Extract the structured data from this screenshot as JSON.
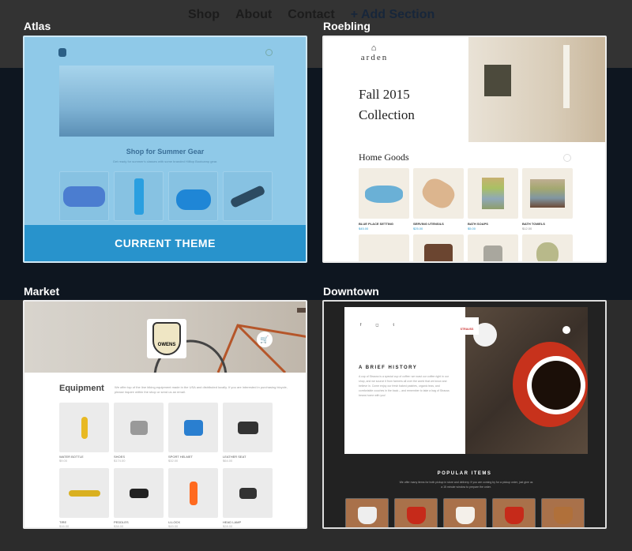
{
  "background": {
    "nav": [
      "Shop",
      "About",
      "Contact",
      "+ Add Section"
    ]
  },
  "themes": [
    {
      "name": "Atlas",
      "current": true,
      "badge": "CURRENT THEME",
      "heading": "Shop for Summer Gear",
      "subtitle": "Get ready for summer's classes with some branded Hilltop Bootcamp gear."
    },
    {
      "name": "Roebling",
      "logo": "arden",
      "headline": [
        "Fall 2015",
        "Collection"
      ],
      "section": "Home Goods",
      "products": [
        {
          "name": "Blue Place Setting",
          "price": "$45.00"
        },
        {
          "name": "Serving Utensils",
          "price": "$25.00"
        },
        {
          "name": "Bath Soaps",
          "price": "$5.00"
        },
        {
          "name": "Bath Towels",
          "price": "$12.00"
        }
      ]
    },
    {
      "name": "Market",
      "logo": "OWENS",
      "section": "Equipment",
      "description": "We offer top of the line biking equipment made in the USA and distributed locally. If you are interested in purchasing bicycle, please inquire within the shop or send us an email.",
      "products": [
        {
          "name": "Water Bottle",
          "price": "$9.00"
        },
        {
          "name": "Shoes",
          "price": "$174.00"
        },
        {
          "name": "Sport Helmet",
          "price": "$32.00"
        },
        {
          "name": "Leather Seat",
          "price": "$64.00"
        },
        {
          "name": "Tire",
          "price": "$16.00"
        },
        {
          "name": "Peddles",
          "price": "$38.00"
        },
        {
          "name": "U-Lock",
          "price": "$49.00"
        },
        {
          "name": "Head Lamp",
          "price": "$28.00"
        }
      ]
    },
    {
      "name": "Downtown",
      "logo": "STRAUSS",
      "heading": "A BRIEF HISTORY",
      "body": "A cup of Strauss is a special cup of coffee: we roast our coffee right in our shop, and we source it from farmers all over the world that we know and believe in. Come enjoy our fresh baked pastries, organic teas, and comfortable couches in the back – and remember to take a bag of Strauss beans home with you!",
      "section": "POPULAR ITEMS",
      "section_text": "We offer many items for both pickup in store and delivery. If you are coming by for a pickup order, just give us a 15 minute window to prepare the order."
    }
  ],
  "colors": {
    "accent": "#2893cc"
  }
}
